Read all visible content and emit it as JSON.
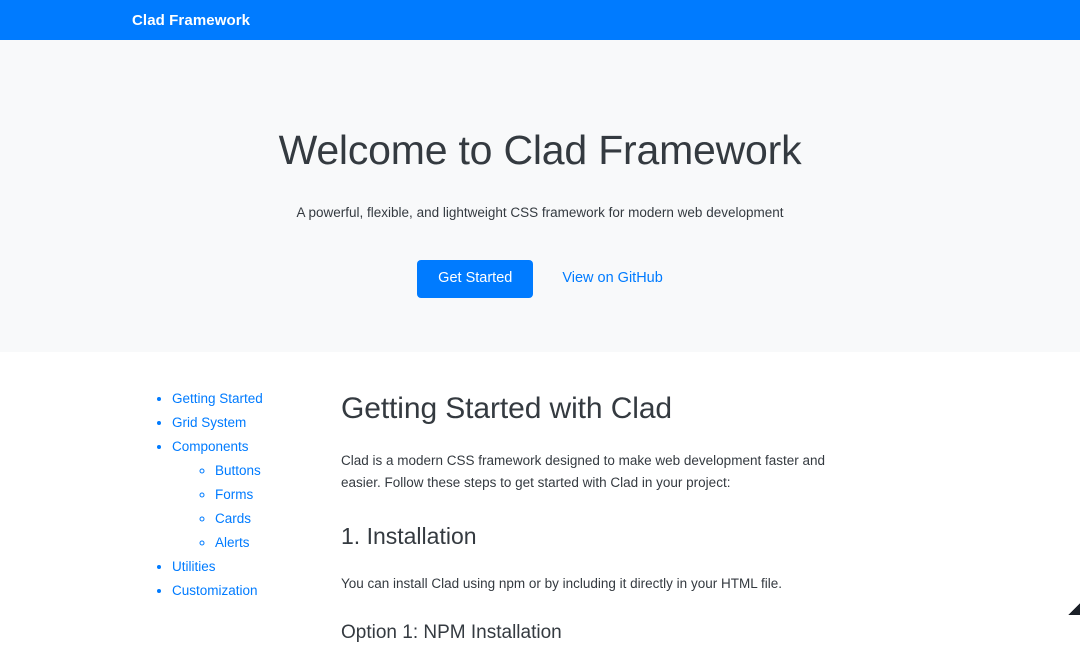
{
  "navbar": {
    "brand": "Clad Framework",
    "background": "#007bff",
    "text_color": "#ffffff"
  },
  "hero": {
    "title": "Welcome to Clad Framework",
    "subtitle": "A powerful, flexible, and lightweight CSS framework for modern web development",
    "primary_button": "Get Started",
    "secondary_link": "View on GitHub",
    "background": "#f8f9fa",
    "accent_color": "#007bff"
  },
  "sidebar": {
    "items": [
      {
        "label": "Getting Started"
      },
      {
        "label": "Grid System"
      },
      {
        "label": "Components",
        "children": [
          {
            "label": "Buttons"
          },
          {
            "label": "Forms"
          },
          {
            "label": "Cards"
          },
          {
            "label": "Alerts"
          }
        ]
      },
      {
        "label": "Utilities"
      },
      {
        "label": "Customization"
      }
    ],
    "link_color": "#007bff"
  },
  "main": {
    "heading": "Getting Started with Clad",
    "intro": "Clad is a modern CSS framework designed to make web development faster and easier. Follow these steps to get started with Clad in your project:",
    "section_1_heading": "1. Installation",
    "section_1_paragraph": "You can install Clad using npm or by including it directly in your HTML file.",
    "option_1_heading": "Option 1: NPM Installation"
  }
}
